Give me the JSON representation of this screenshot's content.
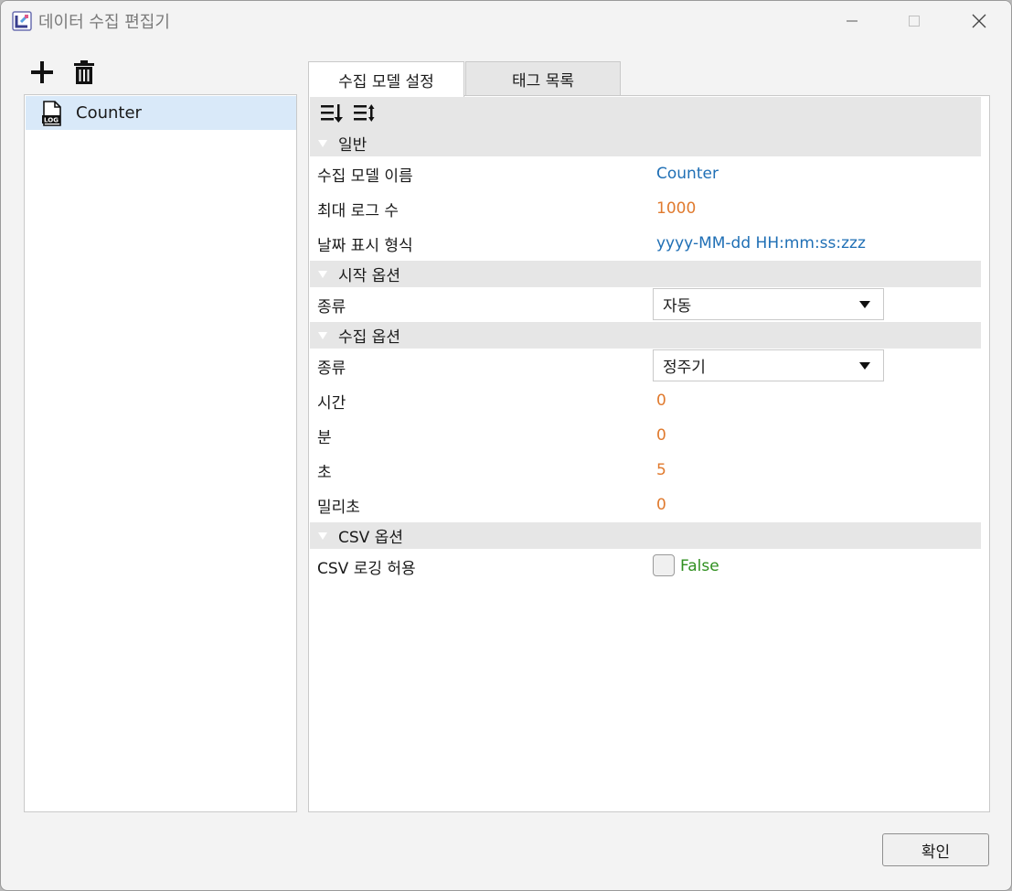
{
  "window": {
    "title": "데이터 수집 편집기"
  },
  "toolbar": {
    "add_icon": "plus-icon",
    "delete_icon": "trash-icon"
  },
  "tree": {
    "items": [
      {
        "label": "Counter",
        "icon": "log-file-icon",
        "selected": true
      }
    ]
  },
  "tabs": [
    {
      "label": "수집 모델 설정",
      "active": true
    },
    {
      "label": "태그 목록",
      "active": false
    }
  ],
  "properties": {
    "sort_icons": [
      "sort-categorized-icon",
      "sort-alphabetical-icon"
    ],
    "general": {
      "label": "일반",
      "model_name": {
        "name": "수집 모델 이름",
        "value": "Counter"
      },
      "max_logs": {
        "name": "최대 로그 수",
        "value": "1000"
      },
      "date_format": {
        "name": "날짜 표시 형식",
        "value": "yyyy-MM-dd HH:mm:ss:zzz"
      }
    },
    "start_options": {
      "label": "시작 옵션",
      "type": {
        "name": "종류",
        "value": "자동"
      }
    },
    "collect_options": {
      "label": "수집 옵션",
      "type": {
        "name": "종류",
        "value": "정주기"
      },
      "hour": {
        "name": "시간",
        "value": "0"
      },
      "minute": {
        "name": "분",
        "value": "0"
      },
      "second": {
        "name": "초",
        "value": "5"
      },
      "millisecond": {
        "name": "밀리초",
        "value": "0"
      }
    },
    "csv_options": {
      "label": "CSV 옵션",
      "allow_logging": {
        "name": "CSV 로깅 허용",
        "value": "False",
        "checked": false
      }
    }
  },
  "footer": {
    "ok_label": "확인"
  },
  "colors": {
    "value_blue": "#1f6fb5",
    "value_orange": "#e07a2e",
    "value_green": "#2f8f1f",
    "selection": "#d9e9f9",
    "category_bg": "#e6e6e6"
  }
}
